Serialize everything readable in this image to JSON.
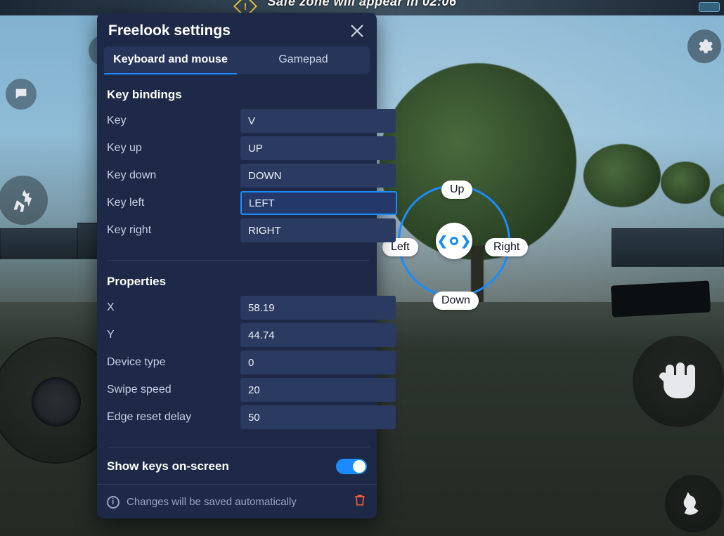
{
  "topbar": {
    "text": "Safe zone will appear in 02:06"
  },
  "panel": {
    "title": "Freelook settings",
    "tabs": {
      "keyboard": "Keyboard and mouse",
      "gamepad": "Gamepad"
    },
    "sections": {
      "bindings_title": "Key bindings",
      "bindings": {
        "key": {
          "label": "Key",
          "value": "V"
        },
        "key_up": {
          "label": "Key up",
          "value": "UP"
        },
        "key_down": {
          "label": "Key down",
          "value": "DOWN"
        },
        "key_left": {
          "label": "Key left",
          "value": "LEFT"
        },
        "key_right": {
          "label": "Key right",
          "value": "RIGHT"
        }
      },
      "properties_title": "Properties",
      "properties": {
        "x": {
          "label": "X",
          "value": "58.19"
        },
        "y": {
          "label": "Y",
          "value": "44.74"
        },
        "device_type": {
          "label": "Device type",
          "value": "0"
        },
        "swipe_speed": {
          "label": "Swipe speed",
          "value": "20"
        },
        "edge_reset": {
          "label": "Edge reset delay",
          "value": "50"
        }
      }
    },
    "show_keys_label": "Show keys on-screen",
    "show_keys_on": true,
    "footer_msg": "Changes will be saved automatically"
  },
  "freelook_widget": {
    "up": "Up",
    "down": "Down",
    "left": "Left",
    "right": "Right"
  },
  "colors": {
    "accent": "#1b8cff",
    "panel_bg": "#1d2947",
    "input_bg": "#2b3a60",
    "danger": "#ff5a3d"
  }
}
